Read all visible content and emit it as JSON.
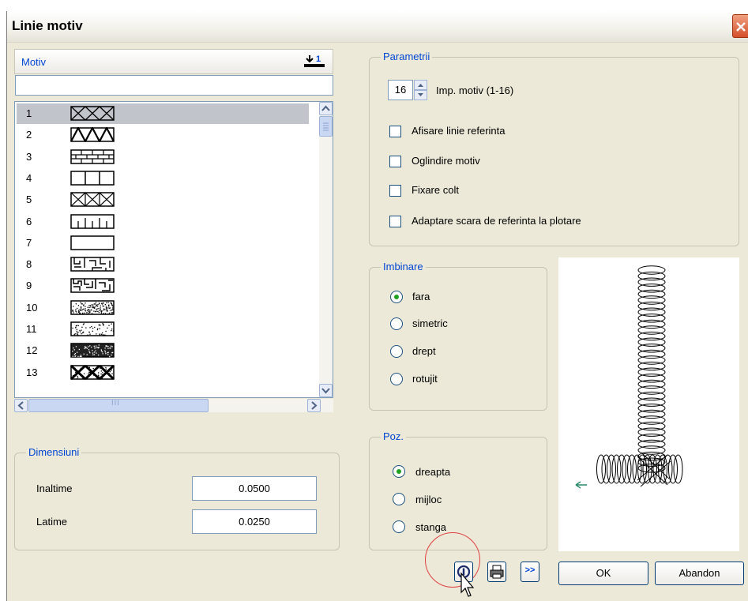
{
  "window": {
    "title": "Linie motiv"
  },
  "motiv": {
    "header_label": "Motiv",
    "filter_value": "",
    "items": [
      {
        "num": "1",
        "pattern": "crosshatch-x-icon"
      },
      {
        "num": "2",
        "pattern": "zigzag-icon"
      },
      {
        "num": "3",
        "pattern": "brick-icon"
      },
      {
        "num": "4",
        "pattern": "vertical-bars-icon"
      },
      {
        "num": "5",
        "pattern": "x-boxes-icon"
      },
      {
        "num": "6",
        "pattern": "ruler-ticks-icon"
      },
      {
        "num": "7",
        "pattern": "empty-rect-icon"
      },
      {
        "num": "8",
        "pattern": "maze-icon"
      },
      {
        "num": "9",
        "pattern": "maze-dense-icon"
      },
      {
        "num": "10",
        "pattern": "stipple-dense-icon"
      },
      {
        "num": "11",
        "pattern": "stipple-light-icon"
      },
      {
        "num": "12",
        "pattern": "stone-dark-icon"
      },
      {
        "num": "13",
        "pattern": "stone-pattern-icon"
      }
    ],
    "selected_index": 0,
    "hscroll_mark": "III"
  },
  "dimensiuni": {
    "label": "Dimensiuni",
    "inaltime_label": "Inaltime",
    "inaltime_value": "0.0500",
    "latime_label": "Latime",
    "latime_value": "0.0250"
  },
  "parametrii": {
    "label": "Parametrii",
    "imp_value": "16",
    "imp_label": "Imp. motiv (1-16)",
    "checks": [
      {
        "label": "Afisare linie referinta",
        "checked": false
      },
      {
        "label": "Oglindire motiv",
        "checked": false
      },
      {
        "label": "Fixare colt",
        "checked": false
      },
      {
        "label": "Adaptare scara de referinta la plotare",
        "checked": false
      }
    ]
  },
  "imbinare": {
    "label": "Imbinare",
    "options": [
      "fara",
      "simetric",
      "drept",
      "rotujit"
    ],
    "selected": 0
  },
  "poz": {
    "label": "Poz.",
    "options": [
      "dreapta",
      "mijloc",
      "stanga"
    ],
    "selected": 0
  },
  "buttons": {
    "ok": "OK",
    "abandon": "Abandon",
    "more": ">>"
  },
  "colors": {
    "accent": "#0046d5",
    "radio_dot": "#21a121",
    "preview_arrow": "#2a8a6a"
  }
}
